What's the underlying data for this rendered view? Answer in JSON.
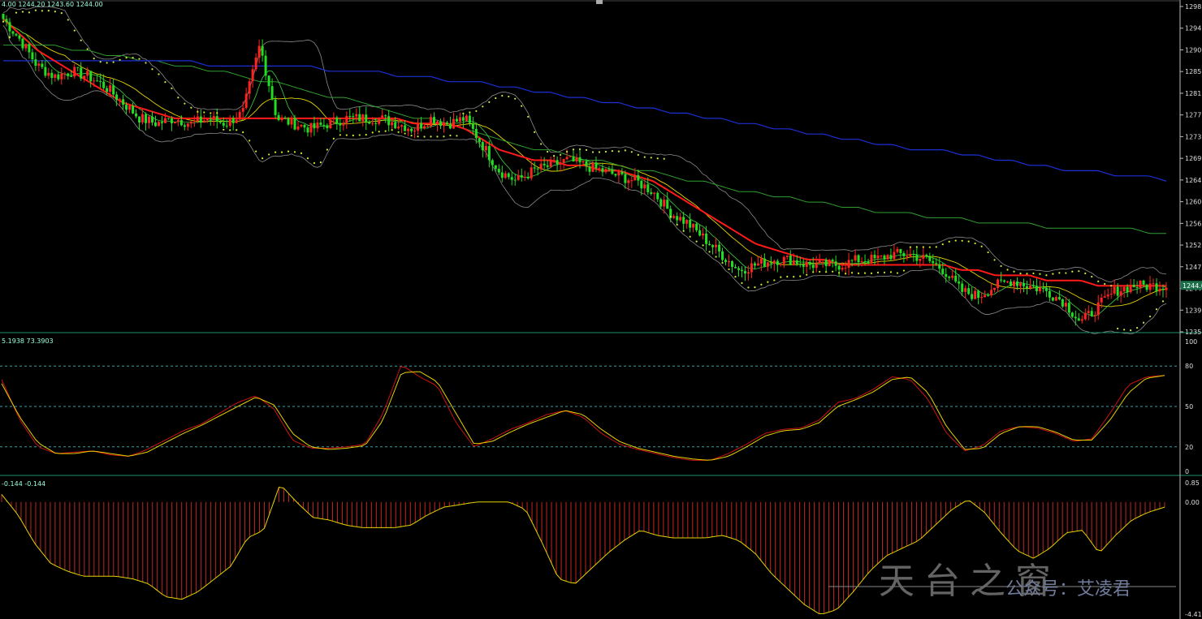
{
  "price_panel": {
    "ohlc_text": "4.00 1244.20 1243.60 1244.00",
    "current_price_tag": "1244.0",
    "y_ticks": [
      "1298",
      "1294.3",
      "1290.1",
      "1285.9",
      "1281.7",
      "1277.4",
      "1273.2",
      "1269.0",
      "1264.8",
      "1260.6",
      "1256.3",
      "1252.1",
      "1247.9",
      "1244.0",
      "1239.5",
      "1235.2"
    ]
  },
  "stoch_panel": {
    "header_text": "5.1938 73.3903",
    "y_ticks": [
      "100",
      "80",
      "50",
      "20",
      "0"
    ]
  },
  "macd_panel": {
    "header_text": "-0.144 -0.144",
    "y_ticks": [
      "0.85",
      "0.00",
      "-4.41"
    ]
  },
  "watermark": {
    "seal_text": "天台之窗",
    "account_text": "公众号：艾凌君"
  },
  "colors": {
    "background": "#000000",
    "bull_candle": "#ff2222",
    "bear_candle": "#22dd22",
    "ma_red": "#ff1a1a",
    "ma_green": "#2f9e2f",
    "ma_blue": "#1c2fd6",
    "ma_yellow": "#e8d400",
    "bollinger": "#8a8a8a",
    "sar_dots": "#ccee33",
    "stoch_main": "#e6d200",
    "stoch_signal": "#cc1111",
    "macd_hist": "#c0261c",
    "macd_signal": "#e6d200",
    "panel_border": "#1f8f6f",
    "level_lines": "#3aa0a0"
  },
  "chart_data": [
    {
      "type": "candlestick",
      "title": "",
      "ylim": [
        1235.2,
        1298
      ],
      "close_path": [
        1295,
        1291,
        1286,
        1284,
        1285,
        1284,
        1282,
        1279,
        1276,
        1275,
        1276,
        1275,
        1276,
        1275,
        1277,
        1290,
        1276,
        1275,
        1274,
        1275,
        1276,
        1276,
        1276,
        1275,
        1274,
        1276,
        1275,
        1276,
        1271,
        1266,
        1264,
        1266,
        1267,
        1268,
        1267,
        1266,
        1265,
        1264,
        1262,
        1258,
        1256,
        1253,
        1250,
        1247,
        1248,
        1249,
        1249,
        1248,
        1248,
        1248,
        1249,
        1249,
        1250,
        1250,
        1249,
        1247,
        1243,
        1242,
        1244,
        1245,
        1244,
        1243,
        1241,
        1237,
        1240,
        1243,
        1244,
        1244,
        1244
      ],
      "ma_red_path": [
        1295,
        1292,
        1289,
        1287,
        1285,
        1283,
        1281,
        1279,
        1278,
        1277,
        1276,
        1276,
        1276,
        1276,
        1276,
        1276,
        1276,
        1276,
        1276,
        1276,
        1276,
        1276,
        1276,
        1276,
        1275,
        1275,
        1275,
        1274,
        1272,
        1270,
        1269,
        1268,
        1268,
        1267,
        1267,
        1266,
        1266,
        1265,
        1264,
        1262,
        1260,
        1258,
        1256,
        1254,
        1252,
        1251,
        1250,
        1249,
        1249,
        1248,
        1248,
        1248,
        1248,
        1248,
        1248,
        1248,
        1247,
        1247,
        1246,
        1246,
        1246,
        1245,
        1245,
        1245,
        1244,
        1244,
        1244,
        1244,
        1244
      ],
      "ma_green_path": [
        1290,
        1290,
        1290,
        1290,
        1289,
        1289,
        1288,
        1288,
        1287,
        1287,
        1286,
        1286,
        1285,
        1285,
        1284,
        1283,
        1283,
        1282,
        1281,
        1280,
        1280,
        1279,
        1278,
        1277,
        1276,
        1276,
        1275,
        1274,
        1273,
        1272,
        1271,
        1270,
        1270,
        1269,
        1268,
        1268,
        1267,
        1266,
        1266,
        1265,
        1264,
        1264,
        1263,
        1262,
        1262,
        1261,
        1261,
        1260,
        1260,
        1259,
        1259,
        1258,
        1258,
        1258,
        1257,
        1257,
        1257,
        1256,
        1256,
        1256,
        1256,
        1255,
        1255,
        1255,
        1255,
        1255,
        1255,
        1254,
        1254
      ],
      "ma_blue_path": [
        1287,
        1287,
        1287,
        1287,
        1287,
        1287,
        1287,
        1287,
        1287,
        1287,
        1287,
        1287,
        1286,
        1286,
        1286,
        1286,
        1286,
        1286,
        1286,
        1285,
        1285,
        1285,
        1285,
        1284,
        1284,
        1284,
        1283,
        1283,
        1283,
        1282,
        1282,
        1281,
        1281,
        1280,
        1280,
        1279,
        1279,
        1278,
        1278,
        1277,
        1277,
        1276,
        1276,
        1275,
        1275,
        1274,
        1274,
        1273,
        1273,
        1272,
        1272,
        1271,
        1271,
        1270,
        1270,
        1270,
        1269,
        1269,
        1268,
        1268,
        1267,
        1267,
        1266,
        1266,
        1266,
        1265,
        1265,
        1265,
        1264
      ]
    },
    {
      "type": "line",
      "title": "",
      "ylim": [
        0,
        100
      ],
      "levels": [
        20,
        50,
        80
      ],
      "series": [
        {
          "values": [
            70,
            40,
            20,
            15,
            16,
            17,
            14,
            13,
            18,
            25,
            32,
            37,
            45,
            53,
            58,
            48,
            25,
            19,
            19,
            20,
            22,
            45,
            81,
            72,
            65,
            38,
            20,
            26,
            33,
            38,
            44,
            47,
            42,
            30,
            22,
            18,
            15,
            12,
            10,
            10,
            15,
            22,
            30,
            33,
            34,
            40,
            53,
            56,
            63,
            72,
            70,
            55,
            30,
            17,
            21,
            32,
            35,
            34,
            30,
            24,
            26,
            45,
            66,
            72,
            73
          ]
        },
        {
          "values": [
            67,
            42,
            23,
            15,
            15,
            17,
            15,
            13,
            16,
            23,
            30,
            36,
            43,
            50,
            57,
            51,
            30,
            20,
            18,
            19,
            21,
            40,
            75,
            76,
            68,
            45,
            22,
            24,
            31,
            37,
            42,
            47,
            44,
            33,
            24,
            19,
            16,
            13,
            11,
            10,
            13,
            20,
            28,
            32,
            33,
            38,
            50,
            55,
            61,
            70,
            72,
            60,
            35,
            18,
            19,
            30,
            35,
            35,
            31,
            25,
            25,
            40,
            60,
            71,
            73
          ]
        }
      ]
    },
    {
      "type": "bar",
      "title": "",
      "ylim": [
        -4.41,
        0.85
      ],
      "values": [
        0.3,
        -0.5,
        -1.6,
        -2.4,
        -2.7,
        -2.9,
        -2.9,
        -2.9,
        -3.0,
        -3.2,
        -3.7,
        -3.8,
        -3.5,
        -3.0,
        -2.5,
        -1.4,
        -1.1,
        0.7,
        0.0,
        -0.6,
        -0.7,
        -0.9,
        -1.0,
        -1.0,
        -1.0,
        -0.9,
        -0.5,
        -0.2,
        -0.1,
        0.0,
        0.0,
        0.0,
        -0.3,
        -1.6,
        -3.0,
        -3.2,
        -2.6,
        -2.0,
        -1.5,
        -1.1,
        -1.3,
        -1.4,
        -1.4,
        -1.4,
        -1.3,
        -1.5,
        -2.0,
        -2.8,
        -3.4,
        -4.0,
        -4.4,
        -4.2,
        -3.5,
        -2.7,
        -2.1,
        -1.8,
        -1.5,
        -0.9,
        -0.3,
        0.1,
        -0.4,
        -1.2,
        -1.9,
        -2.2,
        -1.8,
        -1.2,
        -1.1,
        -2.0,
        -1.3,
        -0.7,
        -0.4,
        -0.2
      ]
    }
  ]
}
